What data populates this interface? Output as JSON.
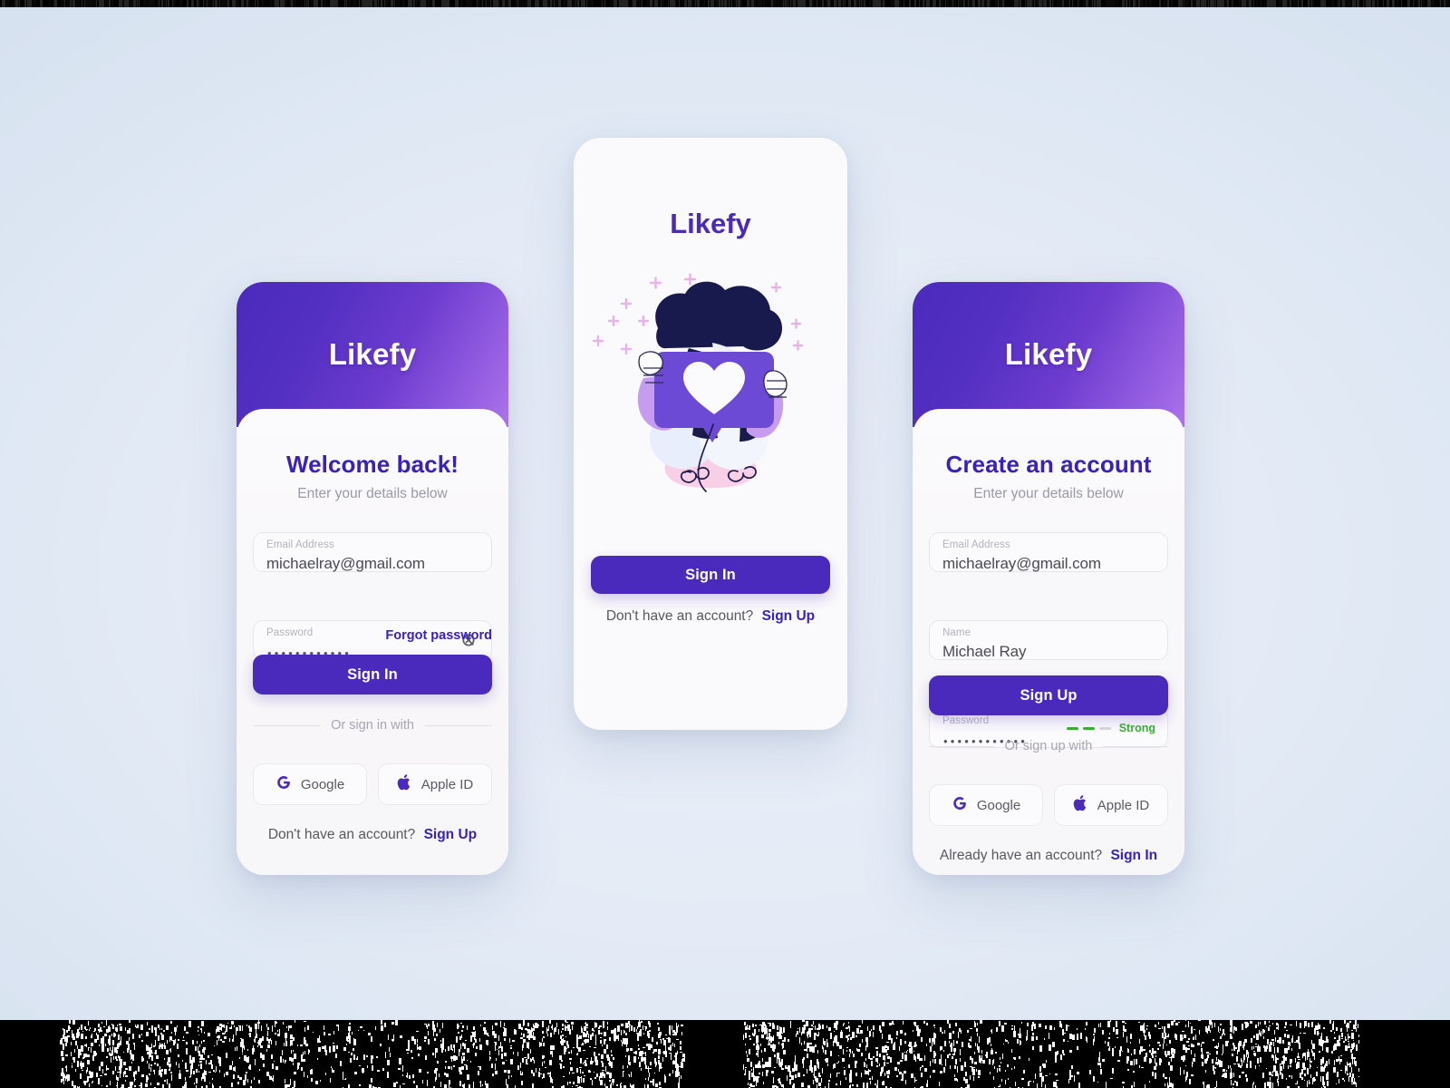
{
  "brand": {
    "name": "Likefy",
    "accent": "#4a2abc",
    "accent_dark": "#3a22b8"
  },
  "background": {
    "color": "#e4ebf6"
  },
  "signin_card": {
    "header_title": "Likefy",
    "heading": "Welcome back!",
    "subheading": "Enter your details below",
    "fields": [
      {
        "label": "Email Address",
        "value": "michaelray@gmail.com",
        "type": "text"
      },
      {
        "label": "Password",
        "value": "••••••••••••",
        "type": "password",
        "icon": "eye-off-icon"
      }
    ],
    "forgot_label": "Forgot password",
    "submit_label": "Sign In",
    "divider_label": "Or sign in with",
    "oauth": [
      {
        "label": "Google",
        "icon": "google-icon"
      },
      {
        "label": "Apple ID",
        "icon": "apple-icon"
      }
    ],
    "footer_text": "Don't have an account?",
    "footer_link": "Sign Up"
  },
  "splash_card": {
    "title": "Likefy",
    "illustration": "person-holding-like-heart-card",
    "submit_label": "Sign In",
    "footer_text": "Don't have an account?",
    "footer_link": "Sign Up"
  },
  "signup_card": {
    "header_title": "Likefy",
    "heading": "Create an account",
    "subheading": "Enter your details below",
    "fields": [
      {
        "label": "Email Address",
        "value": "michaelray@gmail.com",
        "type": "text"
      },
      {
        "label": "Name",
        "value": "Michael Ray",
        "type": "text"
      },
      {
        "label": "Password",
        "value": "••••••••••••",
        "type": "password"
      }
    ],
    "password_strength": {
      "label": "Strong",
      "filled": 2,
      "total": 3,
      "color": "#3bb033"
    },
    "submit_label": "Sign Up",
    "divider_label": "Or sign up with",
    "oauth": [
      {
        "label": "Google",
        "icon": "google-icon"
      },
      {
        "label": "Apple ID",
        "icon": "apple-icon"
      }
    ],
    "footer_text": "Already have an account?",
    "footer_link": "Sign In"
  }
}
